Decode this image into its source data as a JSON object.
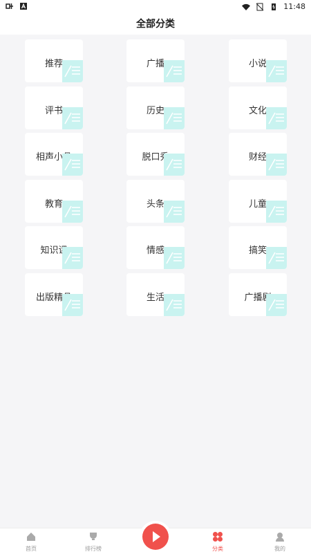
{
  "status_bar": {
    "time": "11:48"
  },
  "header": {
    "title": "全部分类"
  },
  "categories": [
    [
      "推荐",
      "广播",
      "小说"
    ],
    [
      "评书",
      "历史",
      "文化"
    ],
    [
      "相声小品",
      "脱口秀",
      "财经"
    ],
    [
      "教育",
      "头条",
      "儿童"
    ],
    [
      "知识课",
      "情感",
      "搞笑"
    ],
    [
      "出版精品",
      "生活",
      "广播剧"
    ]
  ],
  "tabbar": {
    "tabs": [
      {
        "label": "首页",
        "icon": "home-icon"
      },
      {
        "label": "排行榜",
        "icon": "trophy-icon"
      },
      {
        "label": "",
        "icon": "play-icon"
      },
      {
        "label": "分类",
        "icon": "category-icon"
      },
      {
        "label": "我的",
        "icon": "profile-icon"
      }
    ],
    "active_tab": "分类"
  },
  "colors": {
    "accent": "#f0514c",
    "tile_deco": "#c9f3f0"
  }
}
